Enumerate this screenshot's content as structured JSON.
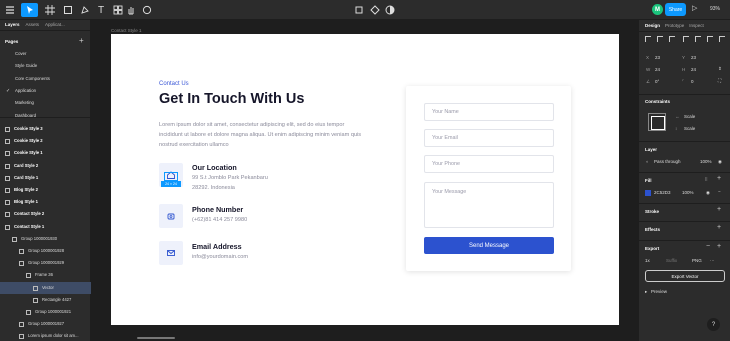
{
  "toolbar": {
    "avatar_letter": "M",
    "share_label": "Share",
    "zoom": "93%"
  },
  "left_panel": {
    "tabs": [
      "Layers",
      "Assets",
      "Applicat..."
    ],
    "pages_heading": "Pages",
    "pages": [
      {
        "label": "Cover",
        "current": false
      },
      {
        "label": "Style Guide",
        "current": false
      },
      {
        "label": "Core Components",
        "current": false
      },
      {
        "label": "Application",
        "current": true
      },
      {
        "label": "Marketing",
        "current": false
      },
      {
        "label": "Dashboard",
        "current": false
      }
    ],
    "layers": [
      {
        "label": "Cookie Style 3",
        "bold": true,
        "indent": 0
      },
      {
        "label": "Cookie Style 2",
        "bold": true,
        "indent": 0
      },
      {
        "label": "Cookie Style 1",
        "bold": true,
        "indent": 0
      },
      {
        "label": "Card Style 2",
        "bold": true,
        "indent": 0
      },
      {
        "label": "Card Style 1",
        "bold": true,
        "indent": 0
      },
      {
        "label": "Blog Style 2",
        "bold": true,
        "indent": 0
      },
      {
        "label": "Blog Style 1",
        "bold": true,
        "indent": 0
      },
      {
        "label": "Contact Style 2",
        "bold": true,
        "indent": 0
      },
      {
        "label": "Contact Style 1",
        "bold": true,
        "indent": 0
      },
      {
        "label": "Group 1000001930",
        "bold": false,
        "indent": 1
      },
      {
        "label": "Group 1000001928",
        "bold": false,
        "indent": 2
      },
      {
        "label": "Group 1000001929",
        "bold": false,
        "indent": 2
      },
      {
        "label": "Frame 36",
        "bold": false,
        "indent": 3
      },
      {
        "label": "Vector",
        "bold": false,
        "indent": 4,
        "selected": true
      },
      {
        "label": "Rectangle 4427",
        "bold": false,
        "indent": 4
      },
      {
        "label": "Group 1000001921",
        "bold": false,
        "indent": 3
      },
      {
        "label": "Group 1000001927",
        "bold": false,
        "indent": 2
      },
      {
        "label": "Lorem ipsum dolor sit am...",
        "bold": false,
        "indent": 2
      }
    ]
  },
  "canvas": {
    "frame_label": "Contact Style 1",
    "eyebrow": "Contact Us",
    "heading": "Get In Touch With Us",
    "paragraph": "Lorem ipsum dolor sit amet, consectetur adipiscing elit, sed do eius tempor incididunt ut labore et dolore magna aliqua. Ut enim adipiscing minim veniam quis nostrud exercitation ullamco",
    "selection_size": "24 × 24",
    "contacts": [
      {
        "title": "Our Location",
        "lines": [
          "99 S.t Jomblo Park Pekanbaru",
          "28292. Indonesia"
        ],
        "icon": "home-icon"
      },
      {
        "title": "Phone Number",
        "lines": [
          "(+62)81 414 257 9980"
        ],
        "icon": "phone-icon"
      },
      {
        "title": "Email Address",
        "lines": [
          "info@yourdomain.com"
        ],
        "icon": "mail-icon"
      }
    ],
    "form": {
      "name_placeholder": "Your Name",
      "email_placeholder": "Your Email",
      "phone_placeholder": "Your Phone",
      "message_placeholder": "Your Message",
      "send_label": "Send Message"
    }
  },
  "right_panel": {
    "tabs": [
      "Design",
      "Prototype",
      "Inspect"
    ],
    "x_label": "X",
    "x_value": "23",
    "y_label": "Y",
    "y_value": "23",
    "w_label": "W",
    "w_value": "24",
    "h_label": "H",
    "h_value": "24",
    "rotation": "0°",
    "radius": "0",
    "constraints_heading": "Constraints",
    "constraint_h": "Scale",
    "constraint_v": "Scale",
    "layer_heading": "Layer",
    "blend_mode": "Pass through",
    "layer_opacity": "100%",
    "fill_heading": "Fill",
    "fill_hex": "2C52D3",
    "fill_opacity": "100%",
    "fill_color": "#2c52cf",
    "stroke_heading": "Stroke",
    "effects_heading": "Effects",
    "export_heading": "Export",
    "export_scale": "1x",
    "export_suffix": "Suffix",
    "export_format": "PNG",
    "export_button": "Export Vector",
    "preview_label": "Preview",
    "help": "?"
  }
}
